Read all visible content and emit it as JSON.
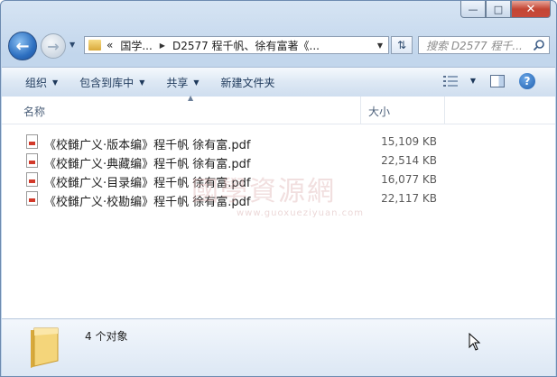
{
  "window": {
    "minimize_glyph": "—",
    "maximize_glyph": "□",
    "close_glyph": "✕"
  },
  "navigation": {
    "address_segments": [
      "«",
      "国学...",
      "D2577 程千帆、徐有富著《..."
    ],
    "search_placeholder": "搜索 D2577 程千...",
    "icons": [
      "back-arrow-icon",
      "forward-arrow-icon",
      "folder-icon",
      "refresh-icon",
      "search-icon"
    ]
  },
  "toolbar": {
    "organize": "组织",
    "include_in_library": "包含到库中",
    "share": "共享",
    "new_folder": "新建文件夹",
    "icons": [
      "view-options-icon",
      "preview-pane-icon",
      "help-icon"
    ]
  },
  "columns": {
    "name": "名称",
    "size": "大小"
  },
  "files": [
    {
      "name": "《校雠广义·版本编》程千帆 徐有富.pdf",
      "size": "15,109 KB"
    },
    {
      "name": "《校雠广义·典藏编》程千帆 徐有富.pdf",
      "size": "22,514 KB"
    },
    {
      "name": "《校雠广义·目录编》程千帆 徐有富.pdf",
      "size": "16,077 KB"
    },
    {
      "name": "《校雠广义·校勘编》程千帆 徐有富.pdf",
      "size": "22,117 KB"
    }
  ],
  "watermark": {
    "main": "國學資源網",
    "sub": "www.guoxueziyuan.com"
  },
  "details": {
    "count_text": "4 个对象"
  },
  "colors": {
    "accent": "#1e395b",
    "pdf_red": "#d23a2a",
    "close_red": "#c44634"
  }
}
